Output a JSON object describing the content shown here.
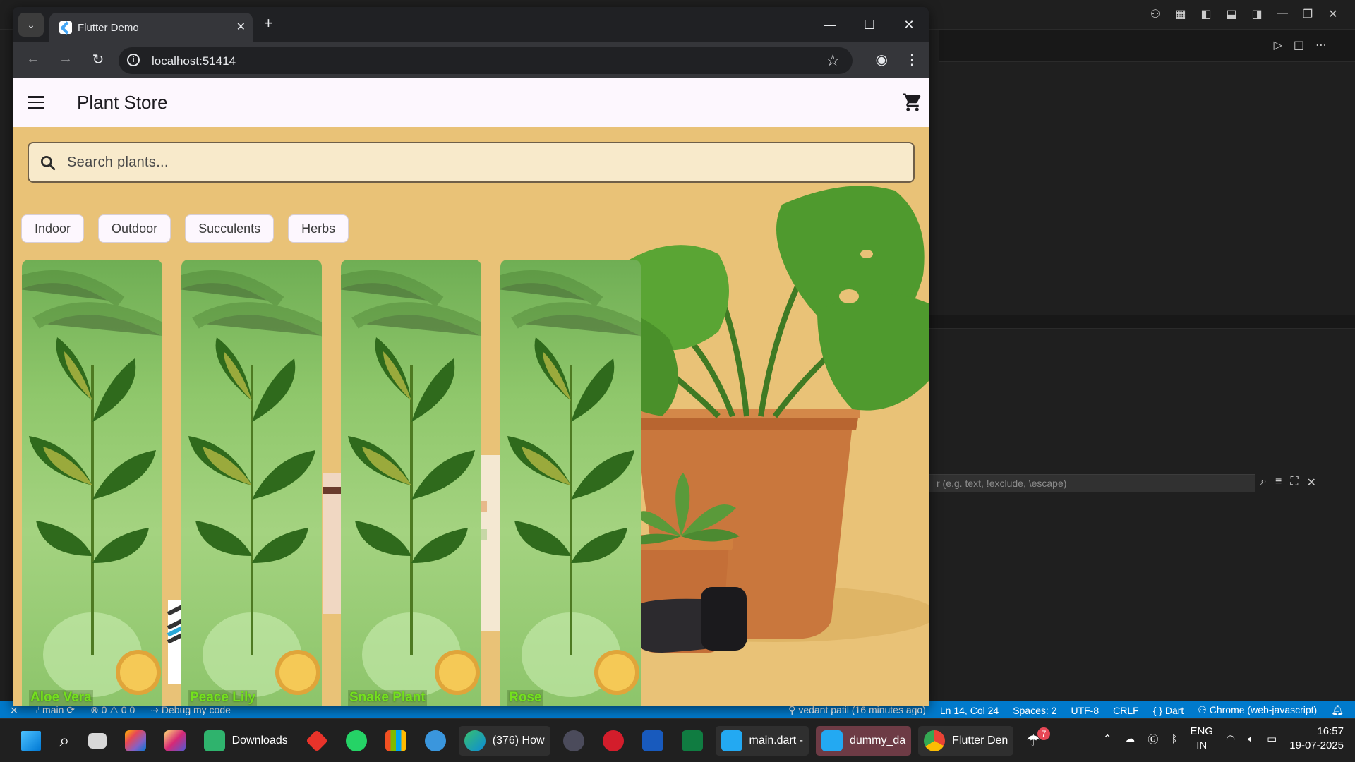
{
  "vscode": {
    "filter_placeholder": "r (e.g. text, !exclude, \\escape)",
    "status": {
      "branch": "main",
      "problems": "⊗ 0 ⚠ 0",
      "ports": "0",
      "debug": "Debug my code",
      "git_blame": "vedant patil (16 minutes ago)",
      "position": "Ln 14, Col 24",
      "spaces": "Spaces: 2",
      "encoding": "UTF-8",
      "eol": "CRLF",
      "language": "Dart",
      "target": "Chrome (web-javascript)"
    }
  },
  "chrome": {
    "tab_title": "Flutter Demo",
    "url": "localhost:51414"
  },
  "app": {
    "title": "Plant Store",
    "search_placeholder": "Search plants...",
    "categories": [
      "Indoor",
      "Outdoor",
      "Succulents",
      "Herbs"
    ],
    "plants": [
      "Aloe Vera",
      "Peace Lily",
      "Snake Plant",
      "Rose"
    ],
    "colors": {
      "background": "#e9c277",
      "appbar": "#fdf7fe",
      "plant_label": "#74e01e"
    }
  },
  "taskbar": {
    "downloads": "Downloads",
    "edge": "(376) How",
    "vscode_main": "main.dart -",
    "vscode_dummy": "dummy_da",
    "chrome": "Flutter Den",
    "weather_badge": "7",
    "lang_1": "ENG",
    "lang_2": "IN",
    "time": "16:57",
    "date": "19-07-2025"
  }
}
